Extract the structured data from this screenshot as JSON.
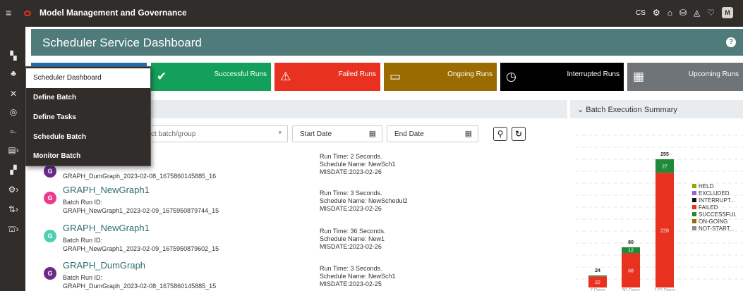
{
  "app": {
    "title": "Model Management and Governance",
    "avatar": "M",
    "shortcode": "CS"
  },
  "header": {
    "title": "Scheduler Service Dashboard",
    "help": "?"
  },
  "tiles": [
    {
      "label": "Successful Runs",
      "icon": "✔",
      "color": "#13a05a"
    },
    {
      "label": "Failed Runs",
      "icon": "⚠",
      "color": "#e8311f"
    },
    {
      "label": "Ongoing Runs",
      "icon": "▭",
      "color": "#9a6b00"
    },
    {
      "label": "Interrupted Runs",
      "icon": "◷",
      "color": "#000000"
    },
    {
      "label": "Upcoming Runs",
      "icon": "▦",
      "color": "#6f7478"
    }
  ],
  "menu": {
    "items": [
      "Scheduler Dashboard",
      "Define Batch",
      "Define Tasks",
      "Schedule Batch",
      "Monitor Batch"
    ]
  },
  "summary": {
    "title": "Batch Execution Summary"
  },
  "filters": {
    "batch_placeholder": "ct batch/group",
    "start_date": "Start Date",
    "end_date": "End Date"
  },
  "runs": [
    {
      "initial": "G",
      "color": "#6b2a8a",
      "name": "",
      "id_label": "",
      "id": "GRAPH_DumGraph_2023-02-08_1675860145885_16",
      "run_time": "Run Time: 2 Seconds.",
      "schedule": "Schedule Name: NewSch1",
      "misdate": "MISDATE:2023-02-26"
    },
    {
      "initial": "G",
      "color": "#e83c8e",
      "name": "GRAPH_NewGraph1",
      "id_label": "Batch Run ID:",
      "id": "GRAPH_NewGraph1_2023-02-09_1675950879744_15",
      "run_time": "Run Time: 3 Seconds.",
      "schedule": "Schedule Name: NewSchedul2",
      "misdate": "MISDATE:2023-02-26"
    },
    {
      "initial": "G",
      "color": "#4fcfb0",
      "name": "GRAPH_NewGraph1",
      "id_label": "Batch Run ID:",
      "id": "GRAPH_NewGraph1_2023-02-09_1675950879602_15",
      "run_time": "Run Time: 36 Seconds.",
      "schedule": "Schedule Name: New1",
      "misdate": "MISDATE:2023-02-26"
    },
    {
      "initial": "G",
      "color": "#6b2a8a",
      "name": "GRAPH_DumGraph",
      "id_label": "Batch Run ID:",
      "id": "GRAPH_DumGraph_2023-02-08_1675860145885_15",
      "run_time": "Run Time: 3 Seconds.",
      "schedule": "Schedule Name: NewSch1",
      "misdate": "MISDATE:2023-02-25"
    }
  ],
  "chart_data": {
    "type": "bar",
    "stacked": true,
    "categories": [
      "7 Days",
      "30 Days",
      "120 Days"
    ],
    "series": [
      {
        "name": "HELD",
        "color": "#8fa900",
        "values": [
          0,
          0,
          0
        ]
      },
      {
        "name": "EXCLUDED",
        "color": "#9b5fd9",
        "values": [
          0,
          0,
          0
        ]
      },
      {
        "name": "INTERRUPT...",
        "color": "#111111",
        "values": [
          0,
          0,
          0
        ]
      },
      {
        "name": "FAILED",
        "color": "#e8311f",
        "values": [
          22,
          68,
          228
        ]
      },
      {
        "name": "SUCCESSFUL",
        "color": "#1f8a3a",
        "values": [
          2,
          12,
          27
        ]
      },
      {
        "name": "ON-GOING",
        "color": "#9a6b00",
        "values": [
          0,
          0,
          0
        ]
      },
      {
        "name": "NOT-START...",
        "color": "#8c8c8c",
        "values": [
          0,
          0,
          0
        ]
      }
    ],
    "totals": [
      24,
      80,
      255
    ],
    "legend": "right",
    "grid": true
  }
}
